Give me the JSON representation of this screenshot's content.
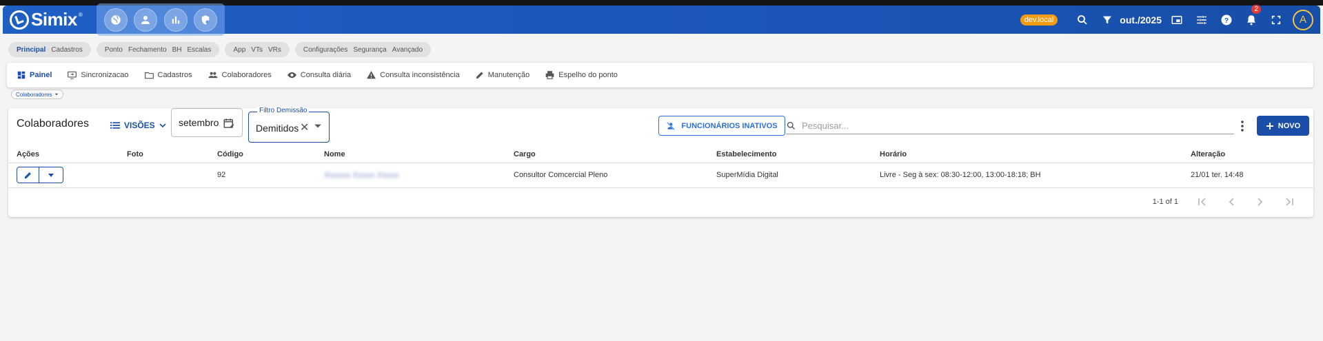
{
  "app": {
    "logo_text": "Simix",
    "reg_mark": "®",
    "env_badge": "dev.local",
    "period": "out./2025",
    "notification_count": "2",
    "avatar_initial": "A",
    "module_icons": [
      "globe-icon",
      "person-icon",
      "bar-chart-icon",
      "shield-icon"
    ]
  },
  "menubar": {
    "groups": [
      [
        "Principal",
        "Cadastros"
      ],
      [
        "Ponto",
        "Fechamento",
        "BH",
        "Escalas"
      ],
      [
        "App",
        "VTs",
        "VRs"
      ],
      [
        "Configurações",
        "Segurança",
        "Avançado"
      ]
    ]
  },
  "subnav": {
    "items": [
      "Painel",
      "Sincronizacao",
      "Cadastros",
      "Colaboradores",
      "Consulta diária",
      "Consulta inconsistência",
      "Manutenção",
      "Espelho do ponto"
    ]
  },
  "breadcrumb_chip": "Colaboradores",
  "card": {
    "title": "Colaboradores",
    "visoes_label": "VISÕES",
    "date_value": "setembro",
    "filter_label": "Filtro Demissão",
    "filter_value": "Demitidos",
    "inativos_label": "FUNCIONÁRIOS INATIVOS",
    "search_placeholder": "Pesquisar...",
    "novo_label": "NOVO"
  },
  "table": {
    "headers": [
      "Ações",
      "Foto",
      "Código",
      "Nome",
      "Cargo",
      "Estabelecimento",
      "Horário",
      "Alteração"
    ],
    "rows": [
      {
        "codigo": "92",
        "nome": "Xxxxxx Xxxxx Xxxxx",
        "cargo": "Consultor Comcercial Pleno",
        "estabelecimento": "SuperMídia Digital",
        "horario": "Livre - Seg à sex: 08:30-12:00, 13:00-18:18; BH",
        "alteracao": "21/01 ter. 14:48"
      }
    ]
  },
  "pager": {
    "info": "1-1 of 1"
  },
  "colors": {
    "primary": "#1b4ea8",
    "topbar": "#1f5fc4",
    "badge": "#f39c12",
    "notify": "#e53935"
  }
}
